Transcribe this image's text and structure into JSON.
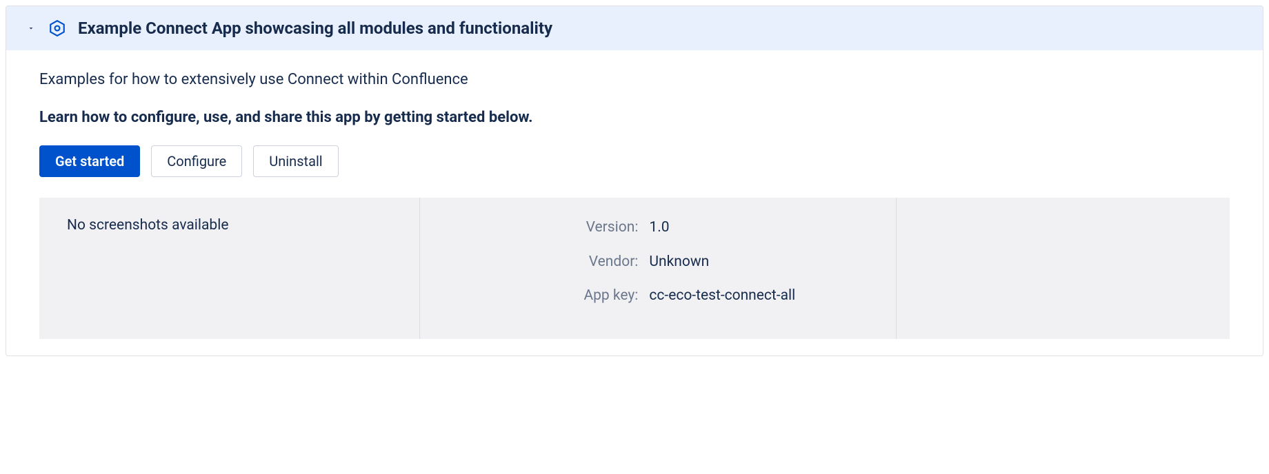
{
  "header": {
    "title": "Example Connect App showcasing all modules and functionality"
  },
  "body": {
    "description": "Examples for how to extensively use Connect within Confluence",
    "instruction": "Learn how to configure, use, and share this app by getting started below."
  },
  "buttons": {
    "get_started": "Get started",
    "configure": "Configure",
    "uninstall": "Uninstall"
  },
  "screenshots": {
    "empty_message": "No screenshots available"
  },
  "details": {
    "version_label": "Version:",
    "version_value": "1.0",
    "vendor_label": "Vendor:",
    "vendor_value": "Unknown",
    "appkey_label": "App key:",
    "appkey_value": "cc-eco-test-connect-all"
  }
}
